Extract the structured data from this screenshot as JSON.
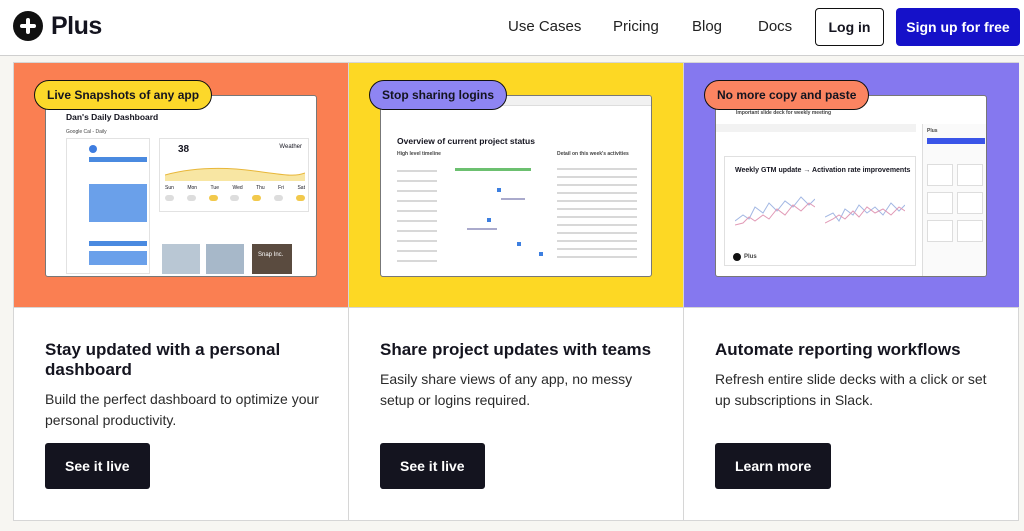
{
  "nav": {
    "brand": "Plus",
    "links": [
      "Use Cases",
      "Pricing",
      "Blog",
      "Docs"
    ],
    "login": "Log in",
    "signup": "Sign up for free"
  },
  "colors": {
    "card1": "#fa7f52",
    "card2": "#fdd824",
    "card3": "#8578ef",
    "pill1": "#fcd82a",
    "pill2": "#8e85f3",
    "pill3": "#fb8461",
    "cta": "#1511c9"
  },
  "cards": [
    {
      "pill": "Live Snapshots of any app",
      "title": "Stay updated with a personal dashboard",
      "desc": "Build the perfect dashboard to optimize your personal productivity.",
      "cta": "See it live",
      "shot": {
        "title": "Dan's Daily Dashboard",
        "weather_temp": "38",
        "weather_label": "Weather",
        "days": [
          "Sun",
          "Mon",
          "Tue",
          "Wed",
          "Thu",
          "Fri",
          "Sat"
        ],
        "calendar_label": "Google Cal - Daily",
        "picture_label": "Snap Inc."
      }
    },
    {
      "pill": "Stop sharing logins",
      "title": "Share project updates with teams",
      "desc": "Easily share views of any app, no messy setup or logins required.",
      "cta": "See it live",
      "shot": {
        "title": "Overview of current project status",
        "left_heading": "High level timeline",
        "right_heading": "Detail on this week's activities"
      }
    },
    {
      "pill": "No more copy and paste",
      "title": "Automate reporting workflows",
      "desc": "Refresh entire slide decks with a click or set up subscriptions in Slack.",
      "cta": "Learn more",
      "shot": {
        "deck_title": "Important slide deck for weekly meeting",
        "slide_title": "Weekly GTM update → Activation rate improvements",
        "brand": "Plus",
        "side_brand": "Plus"
      }
    }
  ]
}
